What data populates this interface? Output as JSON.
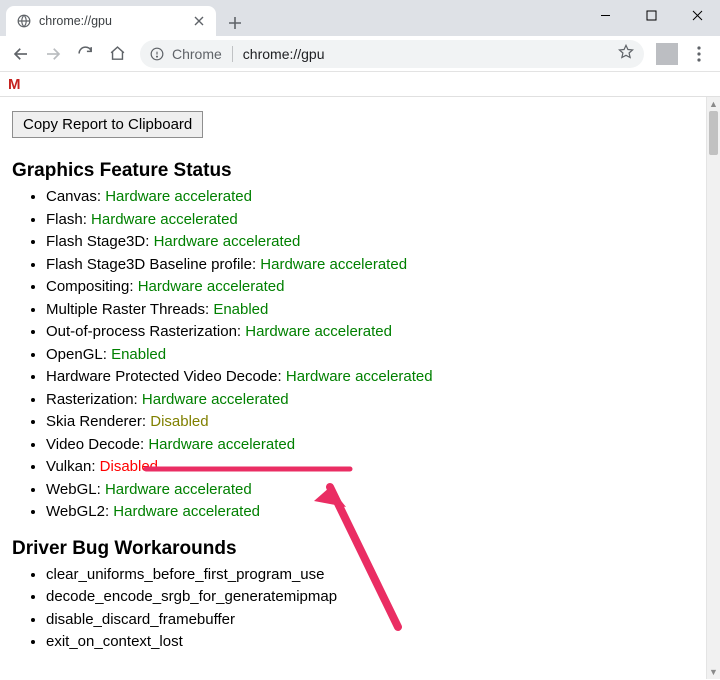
{
  "window": {
    "tab_title": "chrome://gpu",
    "omnibox_chip": "Chrome",
    "omnibox_url": "chrome://gpu"
  },
  "page": {
    "copy_button": "Copy Report to Clipboard",
    "section_features": "Graphics Feature Status",
    "section_workarounds": "Driver Bug Workarounds",
    "features": [
      {
        "label": "Canvas",
        "status": "Hardware accelerated",
        "class": "green"
      },
      {
        "label": "Flash",
        "status": "Hardware accelerated",
        "class": "green"
      },
      {
        "label": "Flash Stage3D",
        "status": "Hardware accelerated",
        "class": "green"
      },
      {
        "label": "Flash Stage3D Baseline profile",
        "status": "Hardware accelerated",
        "class": "green"
      },
      {
        "label": "Compositing",
        "status": "Hardware accelerated",
        "class": "green"
      },
      {
        "label": "Multiple Raster Threads",
        "status": "Enabled",
        "class": "green"
      },
      {
        "label": "Out-of-process Rasterization",
        "status": "Hardware accelerated",
        "class": "green"
      },
      {
        "label": "OpenGL",
        "status": "Enabled",
        "class": "green"
      },
      {
        "label": "Hardware Protected Video Decode",
        "status": "Hardware accelerated",
        "class": "green"
      },
      {
        "label": "Rasterization",
        "status": "Hardware accelerated",
        "class": "green"
      },
      {
        "label": "Skia Renderer",
        "status": "Disabled",
        "class": "olive"
      },
      {
        "label": "Video Decode",
        "status": "Hardware accelerated",
        "class": "green"
      },
      {
        "label": "Vulkan",
        "status": "Disabled",
        "class": "red"
      },
      {
        "label": "WebGL",
        "status": "Hardware accelerated",
        "class": "green"
      },
      {
        "label": "WebGL2",
        "status": "Hardware accelerated",
        "class": "green"
      }
    ],
    "workarounds": [
      "clear_uniforms_before_first_program_use",
      "decode_encode_srgb_for_generatemipmap",
      "disable_discard_framebuffer",
      "exit_on_context_lost"
    ]
  }
}
